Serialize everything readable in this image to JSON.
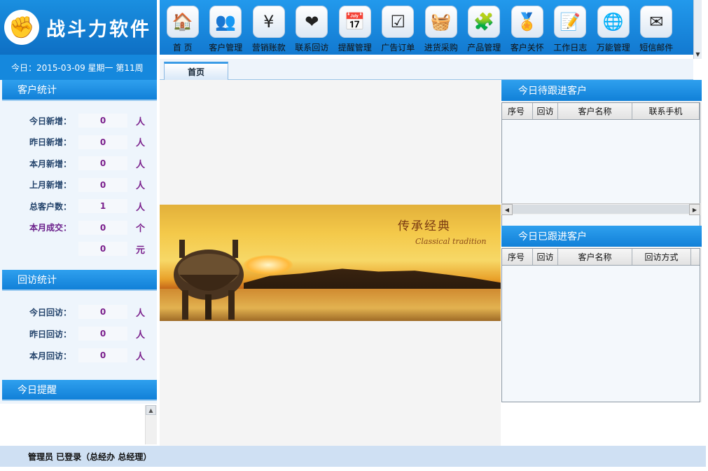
{
  "app": {
    "name": "战斗力软件",
    "logo_glyph": "✊"
  },
  "nav": [
    {
      "label": "首 页",
      "icon": "house-icon",
      "glyph": "🏠"
    },
    {
      "label": "客户管理",
      "icon": "customer-icon",
      "glyph": "👥"
    },
    {
      "label": "营销账款",
      "icon": "yen-icon",
      "glyph": "¥"
    },
    {
      "label": "联系回访",
      "icon": "heart-icon",
      "glyph": "❤"
    },
    {
      "label": "提醒管理",
      "icon": "calendar-icon",
      "glyph": "📅"
    },
    {
      "label": "广告订单",
      "icon": "checkbox-icon",
      "glyph": "☑"
    },
    {
      "label": "进货采购",
      "icon": "basket-icon",
      "glyph": "🧺"
    },
    {
      "label": "产品管理",
      "icon": "product-icon",
      "glyph": "🧩"
    },
    {
      "label": "客户关怀",
      "icon": "medal-icon",
      "glyph": "🏅"
    },
    {
      "label": "工作日志",
      "icon": "notepad-icon",
      "glyph": "📝"
    },
    {
      "label": "万能管理",
      "icon": "globe-icon",
      "glyph": "🌐"
    },
    {
      "label": "短信邮件",
      "icon": "envelope-icon",
      "glyph": "✉"
    }
  ],
  "date_bar": "今日：2015-03-09 星期一 第11周",
  "tabs": {
    "home": "首页"
  },
  "customer_stats": {
    "title": "客户统计",
    "rows": [
      {
        "label": "今日新增：",
        "value": "0",
        "unit": "人"
      },
      {
        "label": "昨日新增：",
        "value": "0",
        "unit": "人"
      },
      {
        "label": "本月新增：",
        "value": "0",
        "unit": "人"
      },
      {
        "label": "上月新增：",
        "value": "0",
        "unit": "人"
      },
      {
        "label": "总客户数：",
        "value": "1",
        "unit": "人"
      },
      {
        "label": "本月成交：",
        "value": "0",
        "unit": "个"
      },
      {
        "label": "",
        "value": "0",
        "unit": "元"
      }
    ]
  },
  "visit_stats": {
    "title": "回访统计",
    "rows": [
      {
        "label": "今日回访：",
        "value": "0",
        "unit": "人"
      },
      {
        "label": "昨日回访：",
        "value": "0",
        "unit": "人"
      },
      {
        "label": "本月回访：",
        "value": "0",
        "unit": "人"
      }
    ]
  },
  "reminder": {
    "title": "今日提醒"
  },
  "banner": {
    "title_cn": "传承经典",
    "title_en": "Classical tradition"
  },
  "pending": {
    "title": "今日待跟进客户",
    "columns": [
      "序号",
      "回访",
      "客户名称",
      "联系手机"
    ]
  },
  "followed": {
    "title": "今日已跟进客户",
    "columns": [
      "序号",
      "回访",
      "客户名称",
      "回访方式"
    ]
  },
  "status": "管理员 已登录（总经办 总经理）"
}
